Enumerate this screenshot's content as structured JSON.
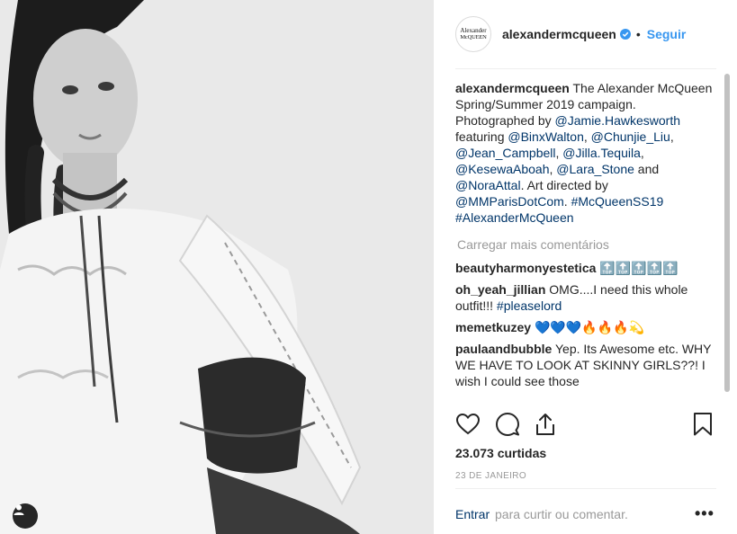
{
  "header": {
    "avatar_line1": "Alexander",
    "avatar_line2": "McQUEEN",
    "username": "alexandermcqueen",
    "dot": "•",
    "follow_label": "Seguir"
  },
  "caption": {
    "username": "alexandermcqueen",
    "text_1": "The Alexander McQueen Spring/Summer 2019 campaign. Photographed by",
    "mention_1": "@Jamie.Hawkesworth",
    "text_2": "featuring",
    "mention_2": "@BinxWalton",
    "mention_3": "@Chunjie_Liu",
    "mention_4": "@Jean_Campbell",
    "mention_5": "@Jilla.Tequila",
    "mention_6": "@KesewaAboah",
    "mention_7": "@Lara_Stone",
    "text_3": "and",
    "mention_8": "@NoraAttal",
    "text_4": ". Art directed by",
    "mention_9": "@MMParisDotCom",
    "hashtag_1": "#McQueenSS19",
    "hashtag_2": "#AlexanderMcQueen"
  },
  "load_more_label": "Carregar mais comentários",
  "comments": [
    {
      "user": "beautyharmonyestetica",
      "text": "🔝🔝🔝🔝🔝"
    },
    {
      "user": "oh_yeah_jillian",
      "text": "OMG....I need this whole outfit!!!",
      "hashtag": "#pleaselord"
    },
    {
      "user": "memetkuzey",
      "text": "💙💙💙🔥🔥🔥💫"
    },
    {
      "user": "paulaandbubble",
      "text": "Yep. Its Awesome etc. WHY WE HAVE TO LOOK AT SKINNY GIRLS??! I wish I could see those"
    }
  ],
  "actions": {
    "like_icon": "heart-icon",
    "comment_icon": "comment-icon",
    "share_icon": "share-icon",
    "save_icon": "bookmark-icon"
  },
  "likes_label": "23.073 curtidas",
  "date_label": "23 DE JANEIRO",
  "footer": {
    "login_label": "Entrar",
    "prompt": "para curtir ou comentar.",
    "more_label": "•••"
  },
  "colors": {
    "link": "#003569",
    "follow": "#3897f0",
    "muted": "#999999",
    "text": "#262626"
  }
}
